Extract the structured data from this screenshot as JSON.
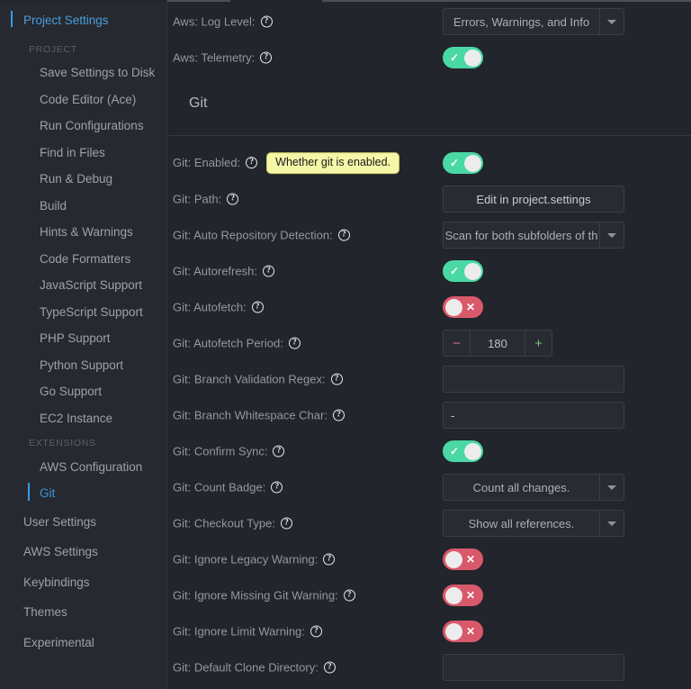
{
  "sidebar": {
    "root": {
      "label": "Project Settings",
      "active": true
    },
    "groups": [
      {
        "label": "PROJECT",
        "items": [
          {
            "label": "Save Settings to Disk"
          },
          {
            "label": "Code Editor (Ace)"
          },
          {
            "label": "Run Configurations"
          },
          {
            "label": "Find in Files"
          },
          {
            "label": "Run & Debug"
          },
          {
            "label": "Build"
          },
          {
            "label": "Hints & Warnings"
          },
          {
            "label": "Code Formatters"
          },
          {
            "label": "JavaScript Support"
          },
          {
            "label": "TypeScript Support"
          },
          {
            "label": "PHP Support"
          },
          {
            "label": "Python Support"
          },
          {
            "label": "Go Support"
          },
          {
            "label": "EC2 Instance"
          }
        ]
      },
      {
        "label": "EXTENSIONS",
        "items": [
          {
            "label": "AWS Configuration"
          },
          {
            "label": "Git",
            "active": true
          }
        ]
      }
    ],
    "secondary": [
      {
        "label": "User Settings"
      },
      {
        "label": "AWS Settings"
      },
      {
        "label": "Keybindings"
      },
      {
        "label": "Themes"
      },
      {
        "label": "Experimental"
      }
    ]
  },
  "tooltip": {
    "text": "Whether git is enabled."
  },
  "colors": {
    "accent": "#2b9fe8",
    "link": "#4a9de0",
    "toggle_on": "#4ad8a4",
    "toggle_off": "#d9596b",
    "tooltip_bg": "#f6f6a8",
    "minus": "#e0707f",
    "plus": "#6dc46d",
    "background": "#22252b",
    "sidebar_bg": "#26292f"
  },
  "main": {
    "aws_rows": [
      {
        "label": "Aws: Log Level:",
        "help": "help-icon",
        "control": "select",
        "value": "Errors, Warnings, and Info"
      },
      {
        "label": "Aws: Telemetry:",
        "help": "help-icon",
        "control": "toggle",
        "value": "on"
      }
    ],
    "section": {
      "title": "Git"
    },
    "git_rows": [
      {
        "label": "Git: Enabled:",
        "help": "help-icon",
        "control": "toggle",
        "value": "on",
        "tooltip": "Whether git is enabled."
      },
      {
        "label": "Git: Path:",
        "help": "help-icon",
        "control": "button",
        "value": "Edit in project.settings"
      },
      {
        "label": "Git: Auto Repository Detection:",
        "help": "help-icon",
        "control": "select",
        "value": "Scan for both subfolders of th"
      },
      {
        "label": "Git: Autorefresh:",
        "help": "help-icon",
        "control": "toggle",
        "value": "on"
      },
      {
        "label": "Git: Autofetch:",
        "help": "help-icon",
        "control": "toggle",
        "value": "off"
      },
      {
        "label": "Git: Autofetch Period:",
        "help": "help-icon",
        "control": "stepper",
        "value": "180",
        "minus": "−",
        "plus": "+"
      },
      {
        "label": "Git: Branch Validation Regex:",
        "help": "help-icon",
        "control": "input",
        "value": "",
        "placeholder": ""
      },
      {
        "label": "Git: Branch Whitespace Char:",
        "help": "help-icon",
        "control": "input",
        "value": "-",
        "placeholder": ""
      },
      {
        "label": "Git: Confirm Sync:",
        "help": "help-icon",
        "control": "toggle",
        "value": "on"
      },
      {
        "label": "Git: Count Badge:",
        "help": "help-icon",
        "control": "select",
        "value": "Count all changes."
      },
      {
        "label": "Git: Checkout Type:",
        "help": "help-icon",
        "control": "select",
        "value": "Show all references."
      },
      {
        "label": "Git: Ignore Legacy Warning:",
        "help": "help-icon",
        "control": "toggle",
        "value": "off"
      },
      {
        "label": "Git: Ignore Missing Git Warning:",
        "help": "help-icon",
        "control": "toggle",
        "value": "off"
      },
      {
        "label": "Git: Ignore Limit Warning:",
        "help": "help-icon",
        "control": "toggle",
        "value": "off"
      },
      {
        "label": "Git: Default Clone Directory:",
        "help": "help-icon",
        "control": "input",
        "value": "",
        "placeholder": ""
      }
    ],
    "help_glyph": "?"
  }
}
